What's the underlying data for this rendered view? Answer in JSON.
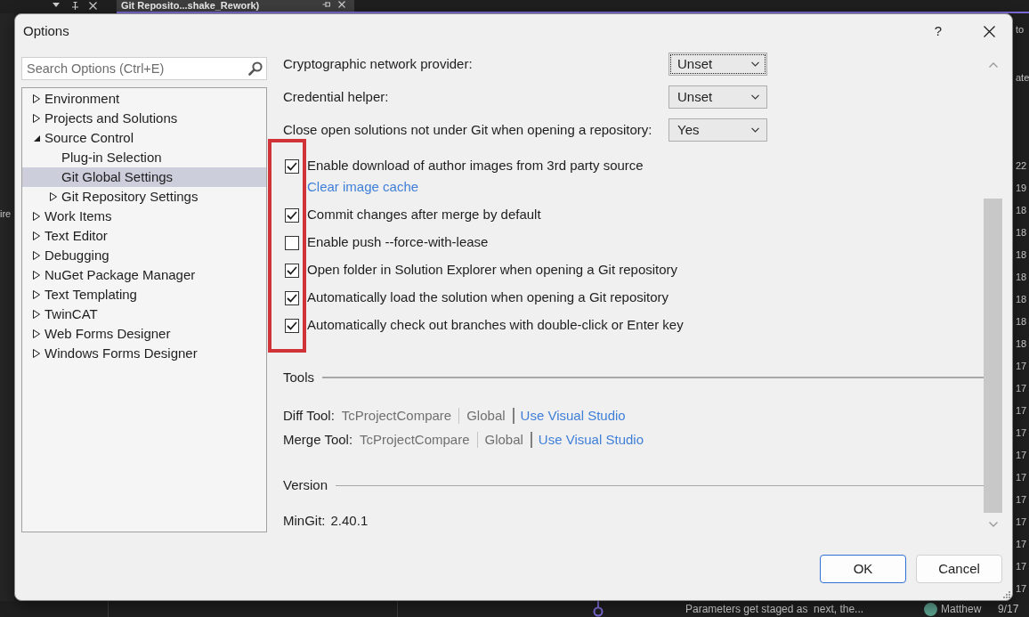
{
  "background": {
    "tab": {
      "title": "Git Reposito...shake_Rework)"
    },
    "left_edge": {
      "text": "ire"
    },
    "right_edge": {
      "texts": [
        "to",
        "ate"
      ],
      "rows": [
        "22",
        "19",
        "18",
        "18",
        "18",
        "18",
        "18",
        "18",
        "18",
        "17",
        "17",
        "17",
        "17",
        "17",
        "17",
        "17",
        "17",
        "17",
        "17",
        "17"
      ]
    },
    "bottom_row": {
      "message": "Parameters get staged as  next, the...",
      "author": "Matthew",
      "date": "9/17"
    }
  },
  "dialog": {
    "title": "Options",
    "help": "?",
    "search": {
      "placeholder": "Search Options (Ctrl+E)"
    },
    "tree": [
      {
        "kind": "branch",
        "label": "Environment",
        "expanded": false,
        "selected": false
      },
      {
        "kind": "branch",
        "label": "Projects and Solutions",
        "expanded": false,
        "selected": false
      },
      {
        "kind": "branch",
        "label": "Source Control",
        "expanded": true,
        "selected": false,
        "children": [
          {
            "kind": "leaf",
            "label": "Plug-in Selection",
            "selected": false
          },
          {
            "kind": "leaf",
            "label": "Git Global Settings",
            "selected": true
          },
          {
            "kind": "branch",
            "label": "Git Repository Settings",
            "expanded": false,
            "selected": false
          }
        ]
      },
      {
        "kind": "branch",
        "label": "Work Items",
        "expanded": false,
        "selected": false
      },
      {
        "kind": "branch",
        "label": "Text Editor",
        "expanded": false,
        "selected": false
      },
      {
        "kind": "branch",
        "label": "Debugging",
        "expanded": false,
        "selected": false
      },
      {
        "kind": "branch",
        "label": "NuGet Package Manager",
        "expanded": false,
        "selected": false
      },
      {
        "kind": "branch",
        "label": "Text Templating",
        "expanded": false,
        "selected": false
      },
      {
        "kind": "branch",
        "label": "TwinCAT",
        "expanded": false,
        "selected": false
      },
      {
        "kind": "branch",
        "label": "Web Forms Designer",
        "expanded": false,
        "selected": false
      },
      {
        "kind": "branch",
        "label": "Windows Forms Designer",
        "expanded": false,
        "selected": false
      }
    ],
    "settings": {
      "dropdowns": [
        {
          "label": "Cryptographic network provider:",
          "value": "Unset",
          "focused": true
        },
        {
          "label": "Credential helper:",
          "value": "Unset",
          "focused": false
        },
        {
          "label": "Close open solutions not under Git when opening a repository:",
          "value": "Yes",
          "focused": false
        }
      ],
      "checkboxes": [
        {
          "label": "Enable download of author images from 3rd party source",
          "checked": true,
          "link": "Clear image cache"
        },
        {
          "label": "Commit changes after merge by default",
          "checked": true
        },
        {
          "label": "Enable push --force-with-lease",
          "checked": false
        },
        {
          "label": "Open folder in Solution Explorer when opening a Git repository",
          "checked": true
        },
        {
          "label": "Automatically load the solution when opening a Git repository",
          "checked": true
        },
        {
          "label": "Automatically check out branches with double-click or Enter key",
          "checked": true
        }
      ]
    },
    "tools": {
      "heading": "Tools",
      "rows": [
        {
          "label": "Diff Tool:",
          "tool": "TcProjectCompare",
          "scope": "Global",
          "action": "Use Visual Studio"
        },
        {
          "label": "Merge Tool:",
          "tool": "TcProjectCompare",
          "scope": "Global",
          "action": "Use Visual Studio"
        }
      ]
    },
    "version": {
      "heading": "Version",
      "items": [
        {
          "label": "MinGit:",
          "value": "2.40.1"
        }
      ]
    },
    "buttons": [
      {
        "label": "OK",
        "default": true
      },
      {
        "label": "Cancel",
        "default": false
      }
    ]
  }
}
